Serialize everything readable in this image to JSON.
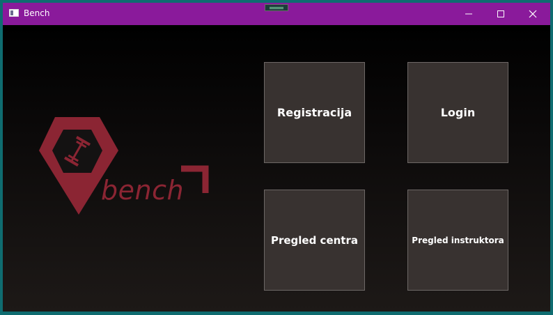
{
  "window": {
    "title": "Bench",
    "titlebar_color": "#8a1a9b"
  },
  "titlebar_controls": {
    "minimize_icon": "minimize-icon",
    "maximize_icon": "maximize-icon",
    "close_icon": "close-icon"
  },
  "logo": {
    "text": "bench",
    "color": "#8b2533"
  },
  "menu": {
    "registracija": "Registracija",
    "login": "Login",
    "pregled_centra": "Pregled centra",
    "pregled_instruktora": "Pregled instruktora"
  }
}
